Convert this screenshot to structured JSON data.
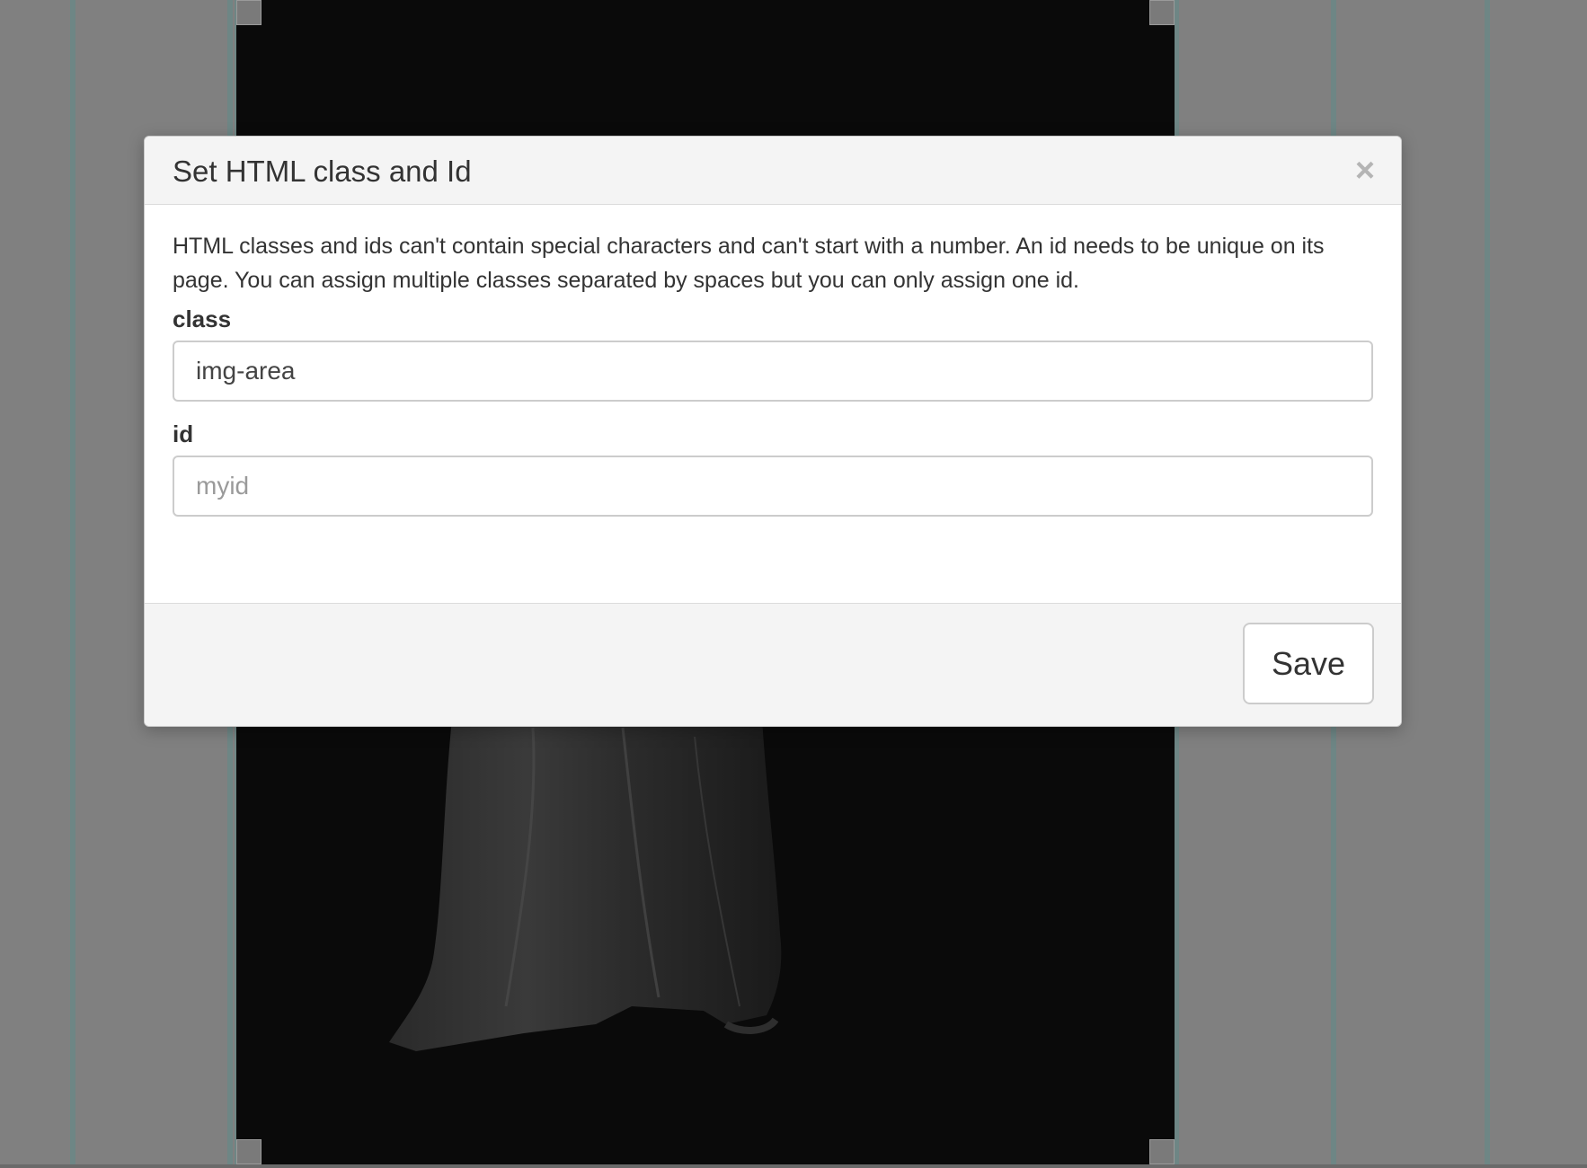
{
  "modal": {
    "title": "Set HTML class and Id",
    "close_icon": "close-icon",
    "close_glyph": "×",
    "description": "HTML classes and ids can't contain special characters and can't start with a number. An id needs to be unique on its page. You can assign multiple classes separated by spaces but you can only assign one id.",
    "class_field": {
      "label": "class",
      "value": "img-area",
      "placeholder": ""
    },
    "id_field": {
      "label": "id",
      "value": "",
      "placeholder": "myid"
    },
    "save_label": "Save"
  },
  "colors": {
    "backdrop": "#808080",
    "image_background": "#0a0a0a",
    "guide_line": "#6e8685",
    "header_footer": "#f4f4f4",
    "close_icon": "#b4b4b4"
  }
}
